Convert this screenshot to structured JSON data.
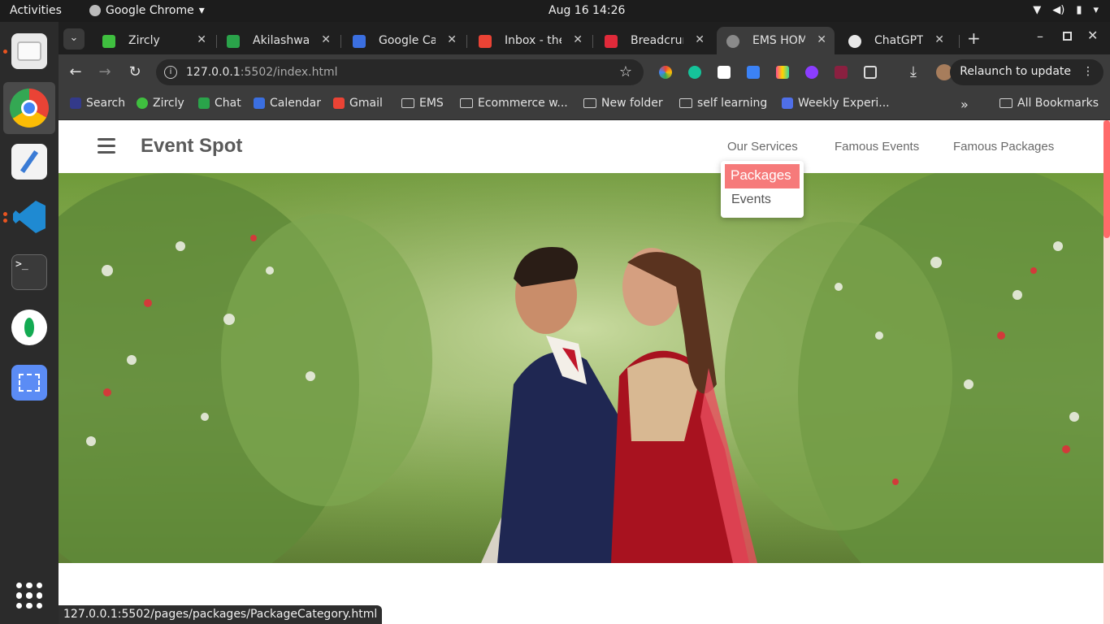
{
  "system_bar": {
    "activities": "Activities",
    "app_name": "Google Chrome",
    "datetime": "Aug 16  14:26"
  },
  "tabs": [
    {
      "title": "Zircly",
      "icon": "zircly-icon",
      "color": "#3fbf3f"
    },
    {
      "title": "Akilashwarr",
      "icon": "chat-icon",
      "color": "#2aa34a"
    },
    {
      "title": "Google Cale",
      "icon": "calendar-icon",
      "color": "#3b6fe0"
    },
    {
      "title": "Inbox - thee",
      "icon": "gmail-icon",
      "color": "#ea4335"
    },
    {
      "title": "Breadcrumb",
      "icon": "s-icon",
      "color": "#e02a3a"
    },
    {
      "title": "EMS HOME",
      "icon": "globe-icon",
      "color": "#8a8a8a",
      "active": true
    },
    {
      "title": "ChatGPT",
      "icon": "chatgpt-icon",
      "color": "#e8e8e8"
    }
  ],
  "address_bar": {
    "host": "127.0.0.1",
    "path": ":5502/index.html"
  },
  "relaunch": {
    "label": "Relaunch to update",
    "menu": "⋮"
  },
  "bookmarks": [
    {
      "label": "Search",
      "icon": "search-icon",
      "color": "#333a8a"
    },
    {
      "label": "Zircly",
      "icon": "zircly-icon",
      "color": "#3fbf3f"
    },
    {
      "label": "Chat",
      "icon": "chat-icon",
      "color": "#2aa34a"
    },
    {
      "label": "Calendar",
      "icon": "calendar-icon",
      "color": "#3b6fe0"
    },
    {
      "label": "Gmail",
      "icon": "gmail-icon",
      "color": "#ea4335"
    },
    {
      "label": "EMS",
      "icon": "folder-icon"
    },
    {
      "label": "Ecommerce w...",
      "icon": "folder-icon"
    },
    {
      "label": "New folder",
      "icon": "folder-icon"
    },
    {
      "label": "self learning",
      "icon": "folder-icon"
    },
    {
      "label": "Weekly Experi...",
      "icon": "doc-icon",
      "color": "#4f6fe8"
    }
  ],
  "all_bookmarks": "All Bookmarks",
  "site": {
    "brand": "Event Spot",
    "nav": [
      "Our Services",
      "Famous Events",
      "Famous Packages"
    ],
    "dropdown": [
      "Packages",
      "Events"
    ],
    "accent": "#f67a7a"
  },
  "status_url": "127.0.0.1:5502/pages/packages/PackageCategory.html"
}
